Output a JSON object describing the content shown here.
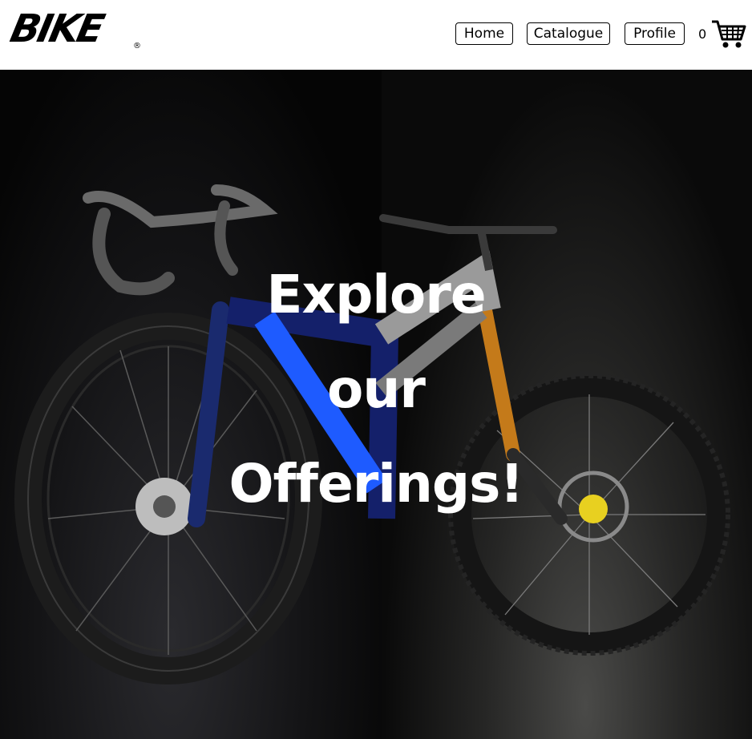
{
  "header": {
    "logo_text": "BIKE",
    "logo_mark": "®",
    "nav": {
      "home_label": "Home",
      "catalogue_label": "Catalogue",
      "profile_label": "Profile"
    },
    "cart": {
      "count": "0",
      "icon": "shopping-cart-icon"
    }
  },
  "hero": {
    "heading_lines": [
      "Explore",
      "our",
      "Offerings!"
    ],
    "left_image": "road-bike-blue",
    "right_image": "mountain-bike-silver"
  },
  "colors": {
    "header_bg": "#ffffff",
    "hero_bg": "#000000",
    "hero_text": "#ffffff",
    "road_bike_accent": "#1e5bff",
    "mtb_fork": "#c47a1a",
    "mtb_hub": "#e8d020"
  }
}
